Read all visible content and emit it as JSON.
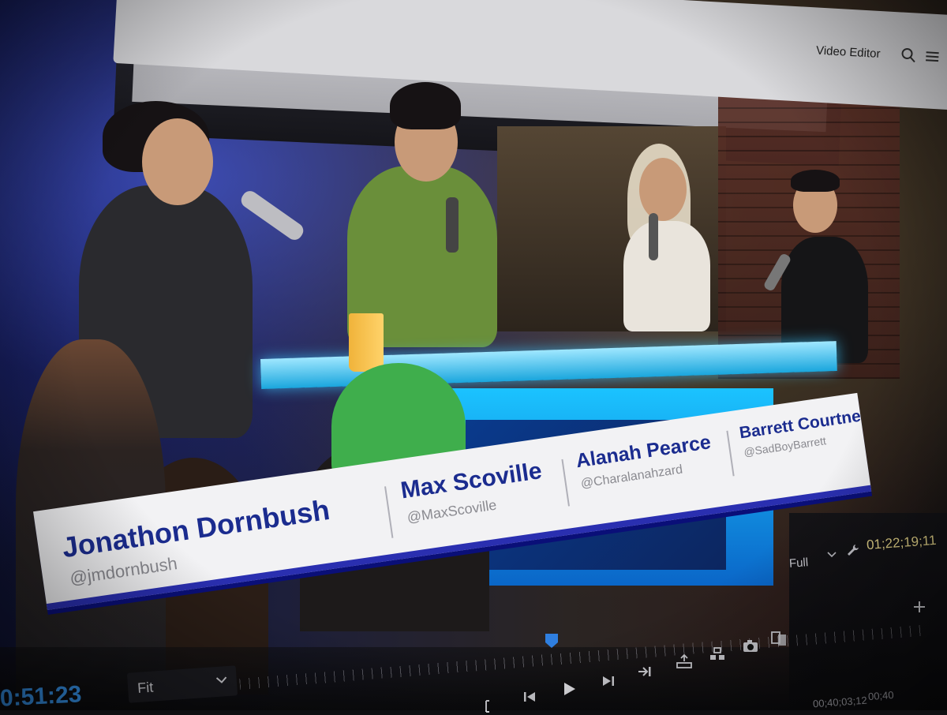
{
  "window": {
    "app_title": "Video Editor",
    "search_icon": "search-icon",
    "menu_icon": "menu-icon"
  },
  "program_monitor": {
    "lower_third": {
      "people": [
        {
          "name": "Jonathon Dornbush",
          "handle": "@jmdornbush"
        },
        {
          "name": "Max Scoville",
          "handle": "@MaxScoville"
        },
        {
          "name": "Alanah Pearce",
          "handle": "@Charalanahzard"
        },
        {
          "name": "Barrett Courtne",
          "handle": "@SadBoyBarrett"
        }
      ],
      "colors": {
        "name_text": "#1b2c8f",
        "plate": "#f2f2f4",
        "accent_bar": "#2a2fb0"
      }
    }
  },
  "controls": {
    "zoom_level": "Fit",
    "resolution": "Full",
    "playhead_timecode": "01;22;19;11",
    "current_timecode": "0:51:23",
    "small_timecodes": [
      "00;40;03;12",
      "00;40"
    ],
    "buttons": [
      {
        "name": "mark-in",
        "icon": "mark-in-icon"
      },
      {
        "name": "step-back",
        "icon": "step-back-icon"
      },
      {
        "name": "play",
        "icon": "play-icon"
      },
      {
        "name": "step-forward",
        "icon": "step-forward-icon"
      },
      {
        "name": "go-to-out",
        "icon": "go-to-out-icon"
      },
      {
        "name": "lift",
        "icon": "lift-icon"
      },
      {
        "name": "extract",
        "icon": "extract-icon"
      },
      {
        "name": "export-frame",
        "icon": "camera-icon"
      },
      {
        "name": "comparison-view",
        "icon": "comparison-icon"
      }
    ],
    "colors": {
      "timecode_right": "#e7d68a",
      "timecode_left": "#3aa0ff",
      "playhead": "#2f7fe0"
    }
  }
}
